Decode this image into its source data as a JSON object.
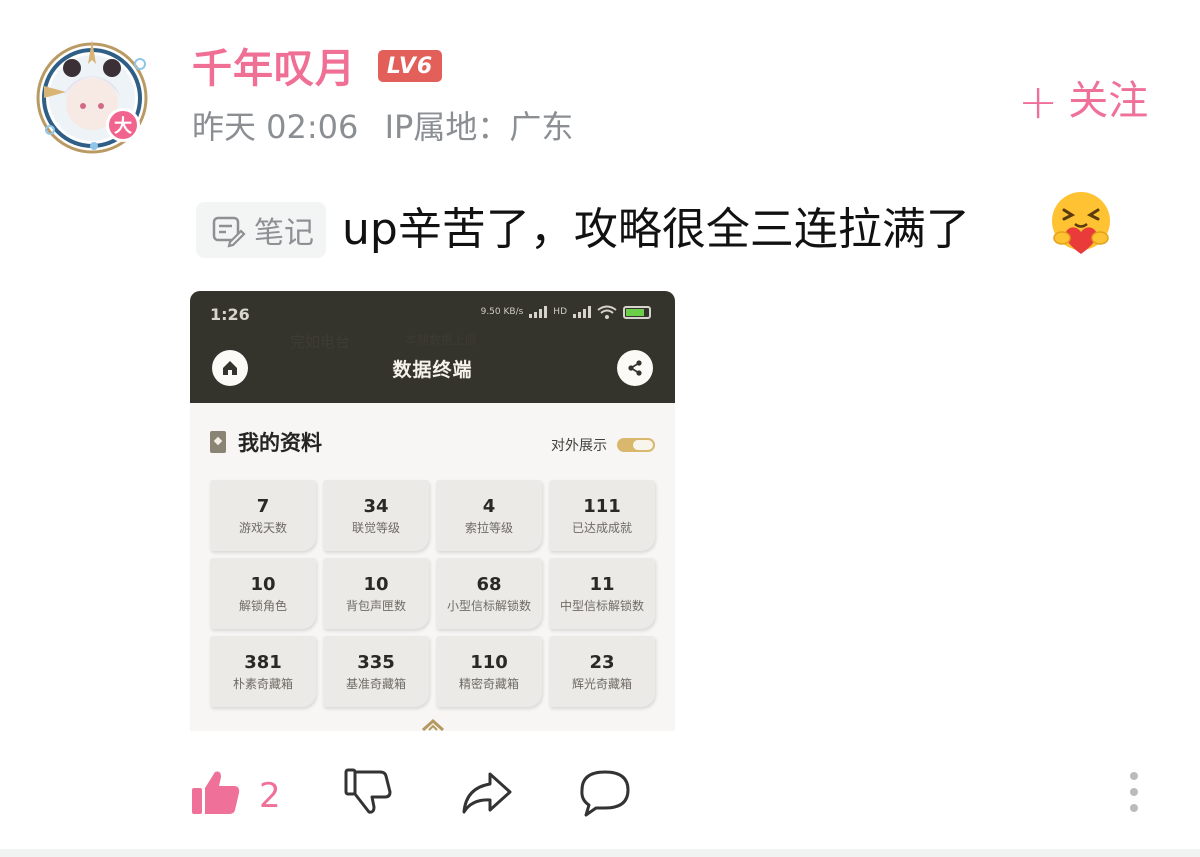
{
  "user": {
    "name": "千年叹月",
    "level": "LV6",
    "verify_badge": "大",
    "time": "昨天 02:06",
    "ip_location": "IP属地：广东"
  },
  "follow": {
    "plus": "+",
    "label": "关注"
  },
  "comment": {
    "tag_label": "笔记",
    "text": "up辛苦了，攻略很全三连拉满了",
    "emoji": "hugging-heart-emoji"
  },
  "screenshot": {
    "status_time": "1:26",
    "status_speed": "9.50 KB/s",
    "status_hd": "HD",
    "battery": "69",
    "ghost_text_1": "完如电台",
    "ghost_text_2": "本期数据上限",
    "title": "数据终端",
    "section_title": "我的资料",
    "toggle_label": "对外展示",
    "stats": [
      {
        "value": "7",
        "label": "游戏天数"
      },
      {
        "value": "34",
        "label": "联觉等级"
      },
      {
        "value": "4",
        "label": "索拉等级"
      },
      {
        "value": "111",
        "label": "已达成成就"
      },
      {
        "value": "10",
        "label": "解锁角色"
      },
      {
        "value": "10",
        "label": "背包声匣数"
      },
      {
        "value": "68",
        "label": "小型信标解锁数"
      },
      {
        "value": "11",
        "label": "中型信标解锁数"
      },
      {
        "value": "381",
        "label": "朴素奇藏箱"
      },
      {
        "value": "335",
        "label": "基准奇藏箱"
      },
      {
        "value": "110",
        "label": "精密奇藏箱"
      },
      {
        "value": "23",
        "label": "辉光奇藏箱"
      }
    ]
  },
  "actions": {
    "like_count": "2"
  },
  "colors": {
    "accent": "#ef7199",
    "level_badge": "#e25f5a",
    "meta_gray": "#8b8f93"
  }
}
